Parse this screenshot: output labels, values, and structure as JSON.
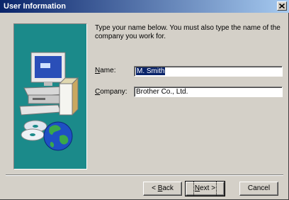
{
  "window": {
    "title": "User Information",
    "close_label": "×"
  },
  "instructions": "Type your name below. You must also type the name of the company you work for.",
  "fields": {
    "name_label": "Name:",
    "name_value": "M. Smith",
    "company_label": "Company:",
    "company_value": "Brother Co., Ltd."
  },
  "buttons": {
    "back": "< Back",
    "next": "Next >",
    "cancel": "Cancel"
  },
  "colors": {
    "titlebar_start": "#0a246a",
    "titlebar_end": "#a6caf0",
    "illustration_bg": "#1b8a8a",
    "dialog_bg": "#d4d0c8"
  },
  "icons": [
    "close-icon",
    "computer-icon",
    "globe-icon",
    "cd-disc-icon"
  ]
}
